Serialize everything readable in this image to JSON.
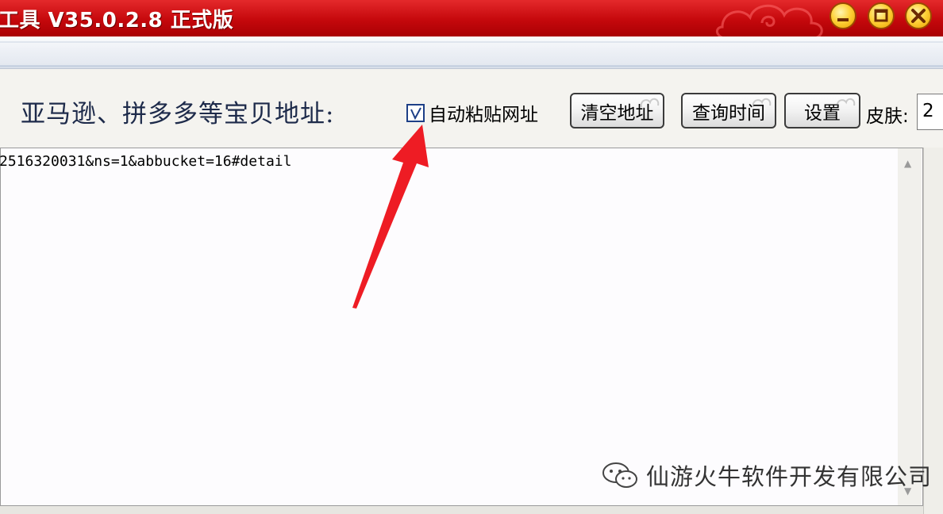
{
  "window": {
    "title": "工具 V35.0.2.8 正式版",
    "controls": [
      "minimize",
      "maximize",
      "close"
    ]
  },
  "toolbar": {
    "url_label": "亚马逊、拼多多等宝贝地址:",
    "auto_paste": {
      "checked": true,
      "label": "自动粘贴网址"
    },
    "clear_button": "清空地址",
    "query_button": "查询时间",
    "settings_button": "设置",
    "skin_label": "皮肤:",
    "skin_value": "2"
  },
  "editor": {
    "content": "2516320031&ns=1&abbucket=16#detail"
  },
  "watermark": {
    "text": "仙游火牛软件开发有限公司",
    "icon": "wechat-icon"
  },
  "annotation": {
    "type": "arrow",
    "color": "#ee1c24",
    "points_to": "auto-paste-checkbox"
  },
  "colors": {
    "titlebar": "#c5080c",
    "window_button": "#ffd23a",
    "label_text": "#1d2a4a"
  }
}
